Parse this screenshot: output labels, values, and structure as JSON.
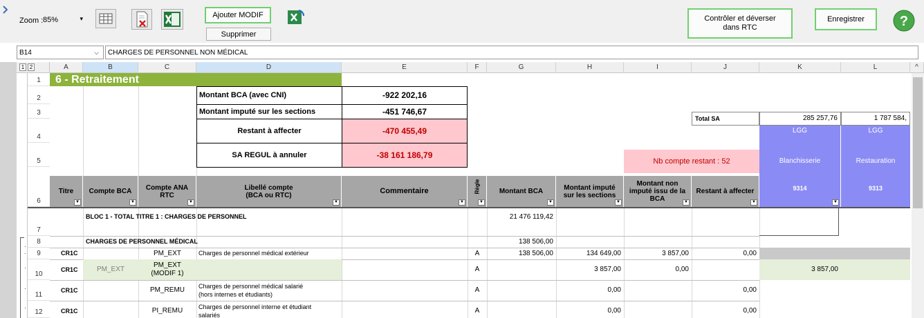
{
  "toolbar": {
    "zoom_label": "Zoom :",
    "zoom_value": "85%",
    "add_modif_label": "Ajouter MODIF",
    "delete_label": "Supprimer",
    "control_label_1": "Contrôler et déverser",
    "control_label_2": "dans RTC",
    "save_label": "Enregistrer"
  },
  "formula_bar": {
    "cell_ref": "B14",
    "content": "CHARGES DE PERSONNEL NON MÉDICAL"
  },
  "grid": {
    "outline_levels": [
      "1",
      "2"
    ],
    "columns": [
      "A",
      "B",
      "C",
      "D",
      "E",
      "F",
      "G",
      "H",
      "I",
      "J",
      "K",
      "L"
    ],
    "row_numbers": [
      "1",
      "2",
      "3",
      "4",
      "5",
      "6",
      "7",
      "8",
      "9",
      "10",
      "11",
      "12"
    ],
    "title": "6 - Retraitement",
    "summary": {
      "montant_bca_label": "Montant BCA (avec CNI)",
      "montant_bca_value": "-922 202,16",
      "montant_impute_label": "Montant imputé sur les sections",
      "montant_impute_value": "-451 746,67",
      "restant_label": "Restant à affecter",
      "restant_value": "-470 455,49",
      "sa_regul_label": "SA REGUL à annuler",
      "sa_regul_value": "-38 161 186,79",
      "nb_compte_restant": "Nb compte restant : 52",
      "total_sa_label": "Total SA",
      "total_sa_k": "285 257,76",
      "total_sa_l": "1 787 584,"
    },
    "section_headers": {
      "k_top": "LGG",
      "l_top": "LGG",
      "k_name": "Blanchisserie",
      "l_name": "Restauration",
      "k_code": "9314",
      "l_code": "9313"
    },
    "headers": {
      "titre": "Titre",
      "compte_bca": "Compte BCA",
      "compte_ana_1": "Compte ANA",
      "compte_ana_2": "RTC",
      "libelle_1": "Libellé compte",
      "libelle_2": "(BCA ou RTC)",
      "commentaire": "Commentaire",
      "regle": "Règle",
      "montant_bca": "Montant BCA",
      "montant_impute_1": "Montant imputé",
      "montant_impute_2": "sur les sections",
      "montant_non_1": "Montant non",
      "montant_non_2": "imputé issu de la",
      "montant_non_3": "BCA",
      "restant": "Restant à affecter"
    },
    "rows": {
      "r7_label": "BLOC 1 - TOTAL TITRE 1 : CHARGES DE PERSONNEL",
      "r7_g": "21 476 119,42",
      "r8_label": "CHARGES DE PERSONNEL MÉDICAL",
      "r8_g": "138 506,00",
      "r9": {
        "a": "CR1C",
        "c": "PM_EXT",
        "d": "Charges de personnel médical extérieur",
        "f": "A",
        "g": "138 506,00",
        "h": "134 649,00",
        "i": "3 857,00",
        "j": "0,00"
      },
      "r10": {
        "a": "CR1C",
        "b": "PM_EXT",
        "c1": "PM_EXT",
        "c2": "(MODIF 1)",
        "f": "A",
        "h": "3 857,00",
        "i": "0,00",
        "k": "3 857,00"
      },
      "r11": {
        "a": "CR1C",
        "c": "PM_REMU",
        "d1": "Charges de personnel médical salarié",
        "d2": "(hors internes et étudiants)",
        "f": "A",
        "h": "0,00",
        "j": "0,00"
      },
      "r12": {
        "a": "CR1C",
        "c": "PI_REMU",
        "d1": "Charges de personnel interne et étudiant",
        "d2": "salariés",
        "f": "A",
        "h": "0,00",
        "j": "0,00"
      }
    }
  }
}
